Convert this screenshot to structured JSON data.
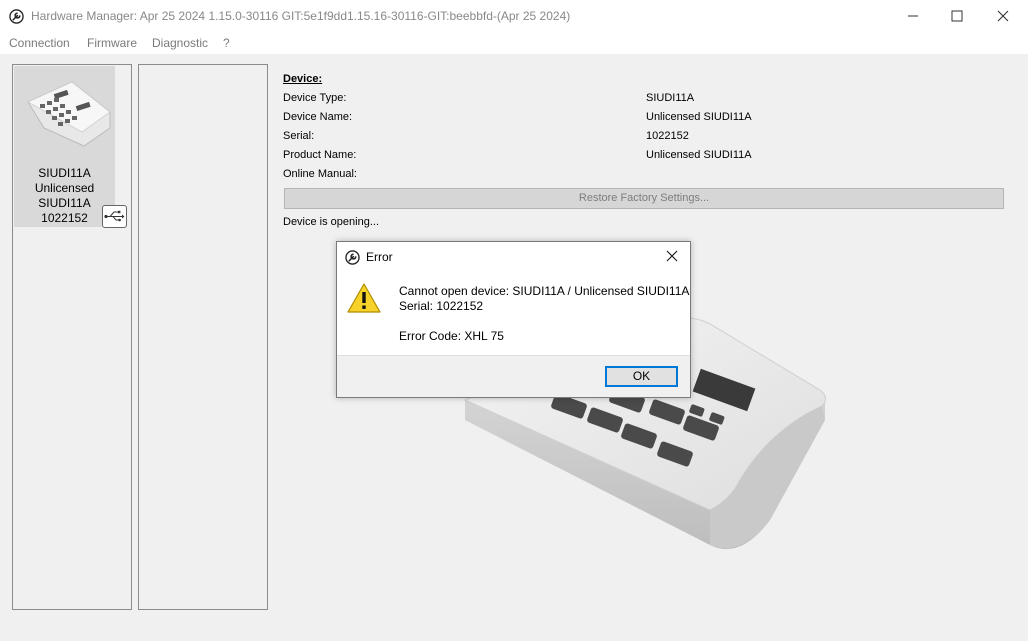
{
  "window": {
    "title": "Hardware Manager: Apr 25 2024 1.15.0-30116 GIT:5e1f9dd1.15.16-30116-GIT:beebbfd-(Apr 25 2024)",
    "app_icon": "wrench-icon"
  },
  "menu": {
    "items": [
      "Connection",
      "Firmware",
      "Diagnostic",
      "?"
    ]
  },
  "device_list": {
    "tile": {
      "lines": [
        "SIUDI11A",
        "Unlicensed",
        "SIUDI11A",
        "1022152"
      ],
      "connection_icon": "usb-icon"
    }
  },
  "device_info": {
    "heading": "Device:",
    "rows": [
      {
        "label": "Device Type:",
        "value": "SIUDI11A"
      },
      {
        "label": "Device Name:",
        "value": "Unlicensed SIUDI11A"
      },
      {
        "label": "Serial:",
        "value": "1022152"
      },
      {
        "label": "Product Name:",
        "value": "Unlicensed SIUDI11A"
      },
      {
        "label": "Online Manual:",
        "value": ""
      }
    ],
    "restore_button": "Restore Factory Settings...",
    "status": "Device is opening..."
  },
  "dialog": {
    "title": "Error",
    "line1": "Cannot open device: SIUDI11A / Unlicensed SIUDI11A",
    "line2": "Serial: 1022152",
    "line3": "Error Code: XHL 75",
    "ok_label": "OK",
    "icon": "warning-icon"
  },
  "colors": {
    "accent": "#0078d7",
    "warning": "#f7d32a"
  }
}
